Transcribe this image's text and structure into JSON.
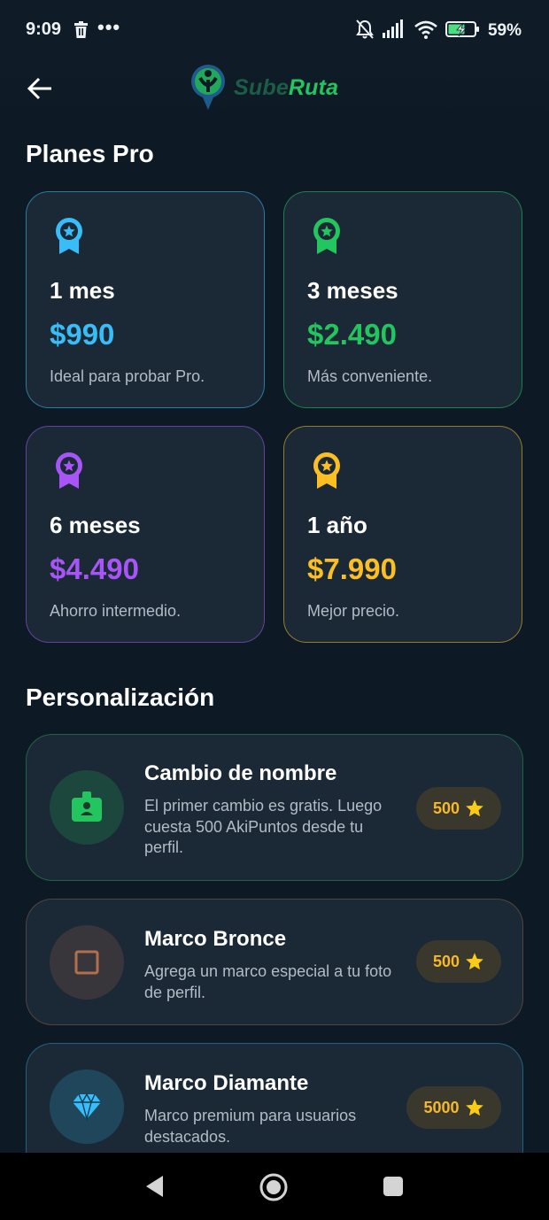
{
  "status_bar": {
    "time": "9:09",
    "battery_percent": "59%",
    "icons": [
      "trash-icon",
      "more-dots-icon",
      "bell-off-icon",
      "signal-icon",
      "wifi-icon",
      "battery-charging-icon"
    ]
  },
  "app_bar": {
    "back_icon": "arrow-left-icon",
    "logo_part1": "Sube",
    "logo_part2": "Ruta"
  },
  "plans_section": {
    "title": "Planes Pro",
    "plans": [
      {
        "name": "1 mes",
        "price": "$990",
        "desc": "Ideal para probar Pro.",
        "color": "#38bdf8",
        "icon": "award-icon"
      },
      {
        "name": "3 meses",
        "price": "$2.490",
        "desc": "Más conveniente.",
        "color": "#22c55e",
        "icon": "award-icon"
      },
      {
        "name": "6 meses",
        "price": "$4.490",
        "desc": "Ahorro intermedio.",
        "color": "#a855f7",
        "icon": "award-icon"
      },
      {
        "name": "1 año",
        "price": "$7.990",
        "desc": "Mejor precio.",
        "color": "#fbbf24",
        "icon": "award-icon"
      }
    ]
  },
  "personalization_section": {
    "title": "Personalización",
    "items": [
      {
        "title": "Cambio de nombre",
        "desc": "El primer cambio es gratis. Luego cuesta 500 AkiPuntos desde tu perfil.",
        "cost": "500",
        "icon": "id-badge-icon",
        "color": "#22c55e"
      },
      {
        "title": "Marco Bronce",
        "desc": "Agrega un marco especial a tu foto de perfil.",
        "cost": "500",
        "icon": "square-frame-icon",
        "color": "#b07050"
      },
      {
        "title": "Marco Diamante",
        "desc": "Marco premium para usuarios destacados.",
        "cost": "5000",
        "icon": "diamond-icon",
        "color": "#38bdf8"
      }
    ]
  },
  "nav_bar": {
    "icons": [
      "back-triangle-icon",
      "home-circle-icon",
      "recents-square-icon"
    ]
  }
}
